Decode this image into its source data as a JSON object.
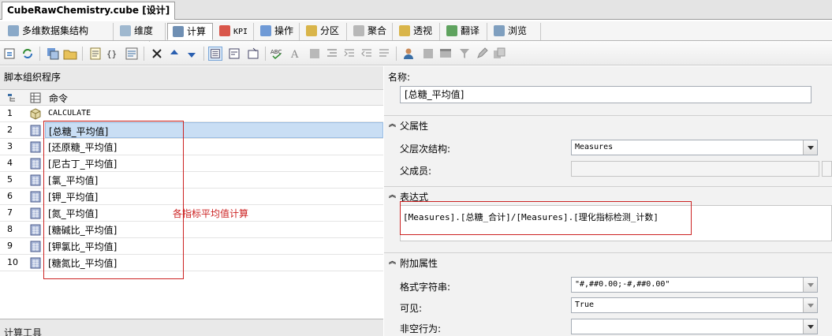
{
  "document_tab": {
    "title": "CubeRawChemistry.cube [设计]"
  },
  "designer_tabs": [
    {
      "label": "多维数据集结构",
      "icon": "cube-structure-icon"
    },
    {
      "label": "维度用法",
      "icon": "dimension-usage-icon"
    },
    {
      "label": "计算",
      "icon": "calculator-icon",
      "active": true
    },
    {
      "label": "KPI",
      "icon": "kpi-icon"
    },
    {
      "label": "操作",
      "icon": "actions-icon"
    },
    {
      "label": "分区",
      "icon": "partitions-icon"
    },
    {
      "label": "聚合",
      "icon": "aggregations-icon"
    },
    {
      "label": "透视",
      "icon": "perspectives-icon"
    },
    {
      "label": "翻译",
      "icon": "translations-icon"
    },
    {
      "label": "浏览器",
      "icon": "browser-icon"
    }
  ],
  "left_pane": {
    "header": "脚本组织程序",
    "column_command": "命令",
    "rows": [
      {
        "num": "1",
        "text": "CALCULATE",
        "mono": true
      },
      {
        "num": "2",
        "text": "[总糖_平均值]",
        "selected": true
      },
      {
        "num": "3",
        "text": "[还原糖_平均值]"
      },
      {
        "num": "4",
        "text": "[尼古丁_平均值]"
      },
      {
        "num": "5",
        "text": "[氯_平均值]"
      },
      {
        "num": "6",
        "text": "[钾_平均值]"
      },
      {
        "num": "7",
        "text": "[氮_平均值]"
      },
      {
        "num": "8",
        "text": "[糖碱比_平均值]"
      },
      {
        "num": "9",
        "text": "[钾氯比_平均值]"
      },
      {
        "num": "10",
        "text": "[糖氮比_平均值]"
      }
    ],
    "annotation": "各指标平均值计算",
    "bottom_stub": "计算工具"
  },
  "right_pane": {
    "name_label": "名称:",
    "name_value": "[总糖_平均值]",
    "parent_section": "父属性",
    "parent_hierarchy_label": "父层次结构:",
    "parent_hierarchy_value": "Measures",
    "parent_member_label": "父成员:",
    "expression_section": "表达式",
    "expression_value": "[Measures].[总糖_合计]/[Measures].[理化指标检测_计数]",
    "additional_section": "附加属性",
    "format_string_label": "格式字符串:",
    "format_string_value": "\"#,##0.00;-#,##0.00\"",
    "visible_label": "可见:",
    "visible_value": "True",
    "non_empty_label": "非空行为:"
  },
  "colors": {
    "annotation_red": "#cc2222",
    "selection_blue": "#c9def4"
  }
}
